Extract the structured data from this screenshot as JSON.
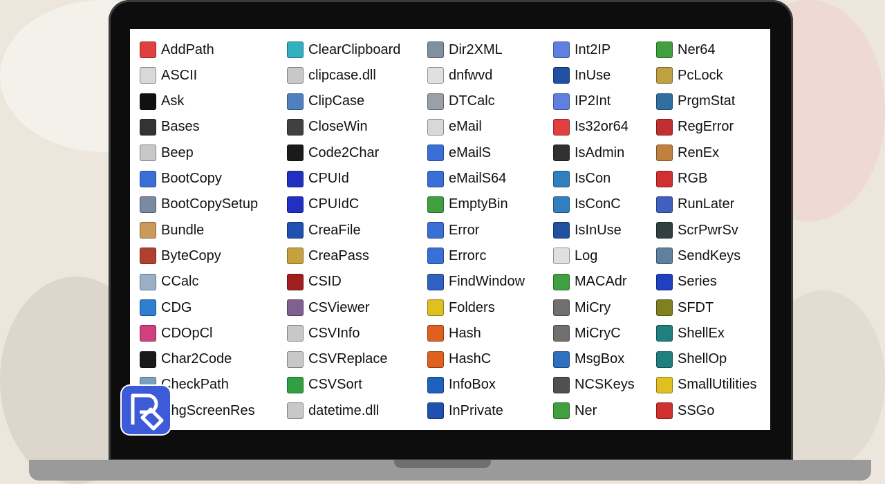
{
  "colors": {
    "screen": "#ffffff",
    "bezel": "#0d0d0d",
    "logo": "#3d5bd9"
  },
  "columns": [
    {
      "items": [
        {
          "label": "AddPath",
          "icon": "addpath-icon",
          "color": "#e04040"
        },
        {
          "label": "ASCII",
          "icon": "document-icon",
          "color": "#d8d8d8"
        },
        {
          "label": "Ask",
          "icon": "console-icon",
          "color": "#111111"
        },
        {
          "label": "Bases",
          "icon": "list-icon",
          "color": "#333333"
        },
        {
          "label": "Beep",
          "icon": "speaker-icon",
          "color": "#c8c8c8"
        },
        {
          "label": "BootCopy",
          "icon": "window-icon",
          "color": "#3a6fd8"
        },
        {
          "label": "BootCopySetup",
          "icon": "setup-icon",
          "color": "#7a8aa0"
        },
        {
          "label": "Bundle",
          "icon": "bundle-icon",
          "color": "#c99a5a"
        },
        {
          "label": "ByteCopy",
          "icon": "tools-icon",
          "color": "#b04030"
        },
        {
          "label": "CCalc",
          "icon": "calculator-icon",
          "color": "#9ab0c8"
        },
        {
          "label": "CDG",
          "icon": "globe-icon",
          "color": "#2f7fd0"
        },
        {
          "label": "CDOpCl",
          "icon": "cd-icon",
          "color": "#d04080"
        },
        {
          "label": "Char2Code",
          "icon": "console-icon",
          "color": "#1a1a1a"
        },
        {
          "label": "CheckPath",
          "icon": "checkpath-icon",
          "color": "#7aa0c0"
        },
        {
          "label": "ChgScreenRes",
          "icon": "screen-icon",
          "color": "#4060a0"
        }
      ]
    },
    {
      "items": [
        {
          "label": "ClearClipboard",
          "icon": "star-icon",
          "color": "#30b0c0"
        },
        {
          "label": "clipcase.dll",
          "icon": "dll-icon",
          "color": "#c8c8c8"
        },
        {
          "label": "ClipCase",
          "icon": "clipboard-icon",
          "color": "#5080c0"
        },
        {
          "label": "CloseWin",
          "icon": "close-window-icon",
          "color": "#404040"
        },
        {
          "label": "Code2Char",
          "icon": "console-icon",
          "color": "#1a1a1a"
        },
        {
          "label": "CPUId",
          "icon": "chip-icon",
          "color": "#2030c0"
        },
        {
          "label": "CPUIdC",
          "icon": "chip-icon",
          "color": "#2030c0"
        },
        {
          "label": "CreaFile",
          "icon": "file-create-icon",
          "color": "#2050b0"
        },
        {
          "label": "CreaPass",
          "icon": "lock-icon",
          "color": "#c8a040"
        },
        {
          "label": "CSID",
          "icon": "barcode-icon",
          "color": "#a02020"
        },
        {
          "label": "CSViewer",
          "icon": "csv-icon",
          "color": "#806090"
        },
        {
          "label": "CSVInfo",
          "icon": "csv-info-icon",
          "color": "#c8c8c8"
        },
        {
          "label": "CSVReplace",
          "icon": "csv-replace-icon",
          "color": "#c8c8c8"
        },
        {
          "label": "CSVSort",
          "icon": "sort-icon",
          "color": "#30a040"
        },
        {
          "label": "datetime.dll",
          "icon": "dll-icon",
          "color": "#c8c8c8"
        }
      ]
    },
    {
      "items": [
        {
          "label": "Dir2XML",
          "icon": "xml-icon",
          "color": "#8090a0"
        },
        {
          "label": "dnfwvd",
          "icon": "version-icon",
          "color": "#e0e0e0"
        },
        {
          "label": "DTCalc",
          "icon": "clock-icon",
          "color": "#9aa0a8"
        },
        {
          "label": "eMail",
          "icon": "mail-icon",
          "color": "#d8d8d8"
        },
        {
          "label": "eMailS",
          "icon": "window-icon",
          "color": "#3a6fd8"
        },
        {
          "label": "eMailS64",
          "icon": "window-icon",
          "color": "#3a6fd8"
        },
        {
          "label": "EmptyBin",
          "icon": "recycle-bin-icon",
          "color": "#40a040"
        },
        {
          "label": "Error",
          "icon": "error-window-icon",
          "color": "#3a6fd8"
        },
        {
          "label": "Errorc",
          "icon": "error-window-icon",
          "color": "#3a6fd8"
        },
        {
          "label": "FindWindow",
          "icon": "find-window-icon",
          "color": "#3060c0"
        },
        {
          "label": "Folders",
          "icon": "checkbox-icon",
          "color": "#e0c020"
        },
        {
          "label": "Hash",
          "icon": "hash-icon",
          "color": "#e06020"
        },
        {
          "label": "HashC",
          "icon": "hash-icon",
          "color": "#e06020"
        },
        {
          "label": "InfoBox",
          "icon": "info-icon",
          "color": "#2060c0"
        },
        {
          "label": "InPrivate",
          "icon": "browser-icon",
          "color": "#2050b0"
        }
      ]
    },
    {
      "items": [
        {
          "label": "Int2IP",
          "icon": "ip-icon",
          "color": "#6080e0"
        },
        {
          "label": "InUse",
          "icon": "inuse-icon",
          "color": "#2050a0"
        },
        {
          "label": "IP2Int",
          "icon": "ip-icon",
          "color": "#6080e0"
        },
        {
          "label": "Is32or64",
          "icon": "bitness-icon",
          "color": "#e04040"
        },
        {
          "label": "IsAdmin",
          "icon": "admin-icon",
          "color": "#303030"
        },
        {
          "label": "IsCon",
          "icon": "network-globe-icon",
          "color": "#3080c0"
        },
        {
          "label": "IsConC",
          "icon": "network-globe-icon",
          "color": "#3080c0"
        },
        {
          "label": "IsInUse",
          "icon": "inuse-icon",
          "color": "#2050a0"
        },
        {
          "label": "Log",
          "icon": "log-icon",
          "color": "#e0e0e0"
        },
        {
          "label": "MACAdr",
          "icon": "network-card-icon",
          "color": "#40a040"
        },
        {
          "label": "MiCry",
          "icon": "safe-icon",
          "color": "#707070"
        },
        {
          "label": "MiCryC",
          "icon": "safe-icon",
          "color": "#707070"
        },
        {
          "label": "MsgBox",
          "icon": "info-bubble-icon",
          "color": "#3070c0"
        },
        {
          "label": "NCSKeys",
          "icon": "keyboard-icon",
          "color": "#505050"
        },
        {
          "label": "Ner",
          "icon": "ner-icon",
          "color": "#40a040"
        }
      ]
    },
    {
      "items": [
        {
          "label": "Ner64",
          "icon": "ner-icon",
          "color": "#40a040"
        },
        {
          "label": "PcLock",
          "icon": "padlock-icon",
          "color": "#c0a040"
        },
        {
          "label": "PrgmStat",
          "icon": "magnifier-icon",
          "color": "#3070a0"
        },
        {
          "label": "RegError",
          "icon": "registry-icon",
          "color": "#c03030"
        },
        {
          "label": "RenEx",
          "icon": "rename-icon",
          "color": "#c08040"
        },
        {
          "label": "RGB",
          "icon": "rgb-icon",
          "color": "#d03030"
        },
        {
          "label": "RunLater",
          "icon": "timer-icon",
          "color": "#4060c0"
        },
        {
          "label": "ScrPwrSv",
          "icon": "screensaver-icon",
          "color": "#304040"
        },
        {
          "label": "SendKeys",
          "icon": "keys-icon",
          "color": "#6080a0"
        },
        {
          "label": "Series",
          "icon": "person-icon",
          "color": "#2040c0"
        },
        {
          "label": "SFDT",
          "icon": "dna-icon",
          "color": "#808020"
        },
        {
          "label": "ShellEx",
          "icon": "shell-icon",
          "color": "#208080"
        },
        {
          "label": "ShellOp",
          "icon": "shell-icon",
          "color": "#208080"
        },
        {
          "label": "SmallUtilities",
          "icon": "help-icon",
          "color": "#e0c020"
        },
        {
          "label": "SSGo",
          "icon": "go-icon",
          "color": "#d03030"
        }
      ]
    }
  ]
}
